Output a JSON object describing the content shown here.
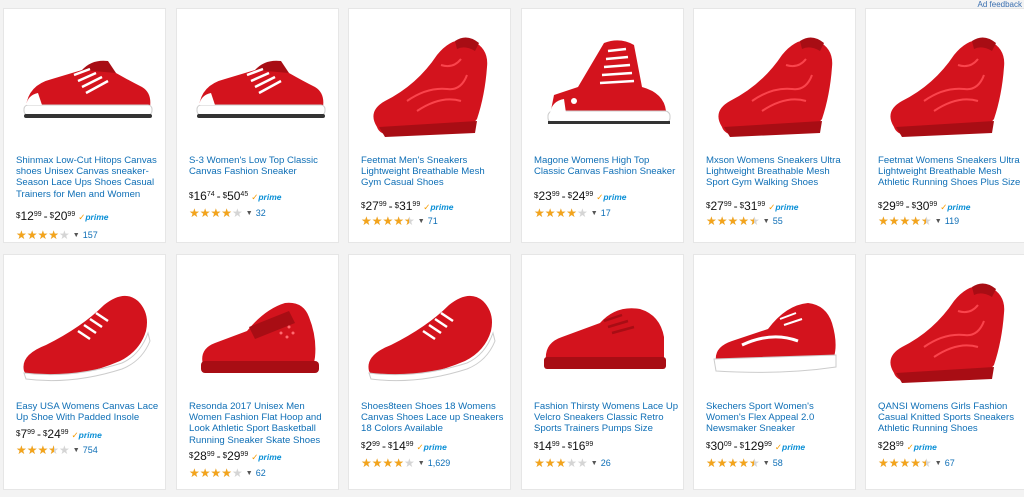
{
  "ad_feedback": "Ad feedback",
  "colors": {
    "link": "#0f6fb6",
    "star": "#f3a41c",
    "prime": "#0a8fd6",
    "shoe": "#d3131d"
  },
  "products": [
    {
      "title": "Shinmax Low-Cut Hitops Canvas shoes Unisex Canvas sneaker-Season Lace Ups Shoes Casual Trainers for Men and Women",
      "price_low": {
        "d": "12",
        "c": "99"
      },
      "price_high": {
        "d": "20",
        "c": "99"
      },
      "prime": "prime",
      "rating": 0.8,
      "reviews": "157",
      "icon": "low-top-canvas-sneaker-image"
    },
    {
      "title": "S-3 Women's Low Top Classic Canvas Fashion Sneaker",
      "price_low": {
        "d": "16",
        "c": "74"
      },
      "price_high": {
        "d": "50",
        "c": "45"
      },
      "prime": "prime",
      "rating": 0.8,
      "reviews": "32",
      "icon": "low-top-canvas-sneaker-image"
    },
    {
      "title": "Feetmat Men's Sneakers Lightweight Breathable Mesh Gym Casual Shoes",
      "price_low": {
        "d": "27",
        "c": "99"
      },
      "price_high": {
        "d": "31",
        "c": "99"
      },
      "prime": "prime",
      "rating": 0.9,
      "reviews": "71",
      "icon": "mesh-running-sneaker-image"
    },
    {
      "title": "Magone Womens High Top Classic Canvas Fashion Sneaker",
      "price_low": {
        "d": "23",
        "c": "99"
      },
      "price_high": {
        "d": "24",
        "c": "99"
      },
      "prime": "prime",
      "rating": 0.8,
      "reviews": "17",
      "icon": "high-top-canvas-sneaker-image"
    },
    {
      "title": "Mxson Womens Sneakers Ultra Lightweight Breathable Mesh Sport Gym Walking Shoes",
      "price_low": {
        "d": "27",
        "c": "99"
      },
      "price_high": {
        "d": "31",
        "c": "99"
      },
      "prime": "prime",
      "rating": 0.9,
      "reviews": "55",
      "icon": "mesh-running-sneaker-image"
    },
    {
      "title": "Feetmat Womens Sneakers Ultra Lightweight Breathable Mesh Athletic Running Shoes Plus Size",
      "price_low": {
        "d": "29",
        "c": "99"
      },
      "price_high": {
        "d": "30",
        "c": "99"
      },
      "prime": "prime",
      "rating": 0.9,
      "reviews": "119",
      "icon": "mesh-running-sneaker-image"
    },
    {
      "title": "Easy USA Womens Canvas Lace Up Shoe With Padded Insole",
      "price_low": {
        "d": "7",
        "c": "99"
      },
      "price_high": {
        "d": "24",
        "c": "99"
      },
      "prime": "prime",
      "rating": 0.7,
      "reviews": "754",
      "icon": "canvas-lace-up-shoe-image"
    },
    {
      "title": "Resonda 2017 Unisex Men Women Fashion Flat Hoop and Look Athletic Sport Basketball Running Sneaker Skate Shoes",
      "price_low": {
        "d": "28",
        "c": "99"
      },
      "price_high": {
        "d": "29",
        "c": "99"
      },
      "prime": "prime",
      "rating": 0.8,
      "reviews": "62",
      "icon": "strap-sneaker-image"
    },
    {
      "title": "Shoes8teen Shoes 18 Womens Canvas Shoes Lace up Sneakers 18 Colors Available",
      "price_low": {
        "d": "2",
        "c": "99"
      },
      "price_high": {
        "d": "14",
        "c": "99"
      },
      "prime": "prime",
      "rating": 0.8,
      "reviews": "1,629",
      "icon": "canvas-lace-up-shoe-image"
    },
    {
      "title": "Fashion Thirsty Womens Lace Up Velcro Sneakers Classic Retro Sports Trainers Pumps Size",
      "price_low": {
        "d": "14",
        "c": "99"
      },
      "price_high": {
        "d": "16",
        "c": "99"
      },
      "prime": "",
      "rating": 0.6,
      "reviews": "26",
      "icon": "retro-trainer-image"
    },
    {
      "title": "Skechers Sport Women's Women's Flex Appeal 2.0 Newsmaker Sneaker",
      "price_low": {
        "d": "30",
        "c": "09"
      },
      "price_high": {
        "d": "129",
        "c": "99"
      },
      "prime": "prime",
      "rating": 0.9,
      "reviews": "58",
      "icon": "sport-sneaker-image"
    },
    {
      "title": "QANSI Womens Girls Fashion Casual Knitted Sports Sneakers Athletic Running Shoes",
      "price_low": {
        "d": "28",
        "c": "99"
      },
      "price_high": null,
      "prime": "prime",
      "rating": 0.9,
      "reviews": "67",
      "icon": "mesh-running-sneaker-image"
    }
  ]
}
